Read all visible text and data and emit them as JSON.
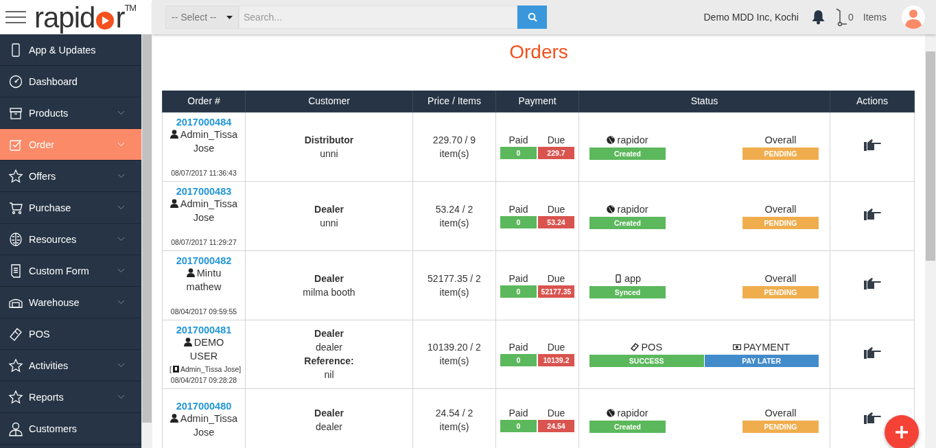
{
  "logo": {
    "text_start": "rapid",
    "text_end": "r",
    "trademark": "TM"
  },
  "header": {
    "select": "-- Select --",
    "search": {
      "placeholder": "Search..."
    },
    "company": "Demo MDD Inc, Kochi",
    "cart_count": "0",
    "cart_label": "Items"
  },
  "sidebar": {
    "items": [
      {
        "label": "App & Updates",
        "kind": "device",
        "submenu": false,
        "selected": false
      },
      {
        "label": "Dashboard",
        "kind": "gauge",
        "submenu": false,
        "selected": false
      },
      {
        "label": "Products",
        "kind": "box",
        "submenu": true,
        "selected": false
      },
      {
        "label": "Order",
        "kind": "check",
        "submenu": true,
        "selected": true
      },
      {
        "label": "Offers",
        "kind": "star",
        "submenu": true,
        "selected": false
      },
      {
        "label": "Purchase",
        "kind": "cart",
        "submenu": true,
        "selected": false
      },
      {
        "label": "Resources",
        "kind": "brain",
        "submenu": true,
        "selected": false
      },
      {
        "label": "Custom Form",
        "kind": "form",
        "submenu": true,
        "selected": false
      },
      {
        "label": "Warehouse",
        "kind": "warehouse",
        "submenu": true,
        "selected": false
      },
      {
        "label": "POS",
        "kind": "tag",
        "submenu": false,
        "selected": false
      },
      {
        "label": "Activities",
        "kind": "star",
        "submenu": true,
        "selected": false
      },
      {
        "label": "Reports",
        "kind": "star",
        "submenu": true,
        "selected": false
      },
      {
        "label": "Customers",
        "kind": "person",
        "submenu": false,
        "selected": false
      }
    ]
  },
  "page_title": "Orders",
  "table": {
    "columns": [
      "Order #",
      "Customer",
      "Price / Items",
      "Payment",
      "Status",
      "Actions"
    ],
    "rows": [
      {
        "order": "2017000484",
        "user": "Admin_Tissa Jose",
        "date": "08/07/2017 11:36:43",
        "customer_type": "Distributor",
        "customer": "unni",
        "price": "229.70 / 9 item(s)",
        "paid_label": "Paid",
        "paid": "0",
        "due_label": "Due",
        "due": "229.7",
        "status": {
          "kind": "split",
          "left": {
            "kind": "web",
            "label": "rapidor",
            "badge": "Created",
            "color": "#5cb85c"
          },
          "right": {
            "kind": "plain",
            "label": "Overall",
            "badge": "PENDING",
            "color": "#f0ad4e"
          }
        }
      },
      {
        "order": "2017000483",
        "user": "Admin_Tissa Jose",
        "date": "08/07/2017 11:29:27",
        "customer_type": "Dealer",
        "customer": "unni",
        "price": "53.24 / 2 item(s)",
        "paid_label": "Paid",
        "paid": "0",
        "due_label": "Due",
        "due": "53.24",
        "status": {
          "kind": "split",
          "left": {
            "kind": "web",
            "label": "rapidor",
            "badge": "Created",
            "color": "#5cb85c"
          },
          "right": {
            "kind": "plain",
            "label": "Overall",
            "badge": "PENDING",
            "color": "#f0ad4e"
          }
        }
      },
      {
        "order": "2017000482",
        "user": "Mintu mathew",
        "date": "08/04/2017 09:59:55",
        "customer_type": "Dealer",
        "customer": "milma booth",
        "price": "52177.35 / 2 item(s)",
        "paid_label": "Paid",
        "paid": "0",
        "due_label": "Due",
        "due": "52177.35",
        "status": {
          "kind": "split",
          "left": {
            "kind": "app",
            "label": "app",
            "badge": "Synced",
            "color": "#5cb85c"
          },
          "right": {
            "kind": "plain",
            "label": "Overall",
            "badge": "PENDING",
            "color": "#f0ad4e"
          }
        }
      },
      {
        "order": "2017000481",
        "user": "DEMO USER",
        "via": {
          "open": "[",
          "name": "Admin_Tissa Jose",
          "close": "]"
        },
        "date": "08/04/2017 09:28:28",
        "customer_type": "Dealer",
        "customer": "dealer",
        "reference_label": "Reference:",
        "reference": "nil",
        "price": "10139.20 / 2 item(s)",
        "paid_label": "Paid",
        "paid": "0",
        "due_label": "Due",
        "due": "10139.2",
        "status": {
          "kind": "full",
          "left": {
            "kind": "pos",
            "label": "POS",
            "badge": "SUCCESS",
            "color": "#5cb85c"
          },
          "right": {
            "kind": "payment",
            "label": "PAYMENT",
            "badge": "PAY LATER",
            "color": "#428bca"
          }
        }
      },
      {
        "order": "2017000480",
        "user": "Admin_Tissa Jose",
        "customer_type": "Dealer",
        "customer": "dealer",
        "price": "24.54 / 2 item(s)",
        "paid_label": "Paid",
        "paid": "0",
        "due_label": "Due",
        "due": "24.54",
        "status": {
          "kind": "split",
          "left": {
            "kind": "web",
            "label": "rapidor",
            "badge": "Created",
            "color": "#5cb85c"
          },
          "right": {
            "kind": "plain",
            "label": "Overall",
            "badge": "PENDING",
            "color": "#f0ad4e"
          }
        }
      }
    ]
  }
}
